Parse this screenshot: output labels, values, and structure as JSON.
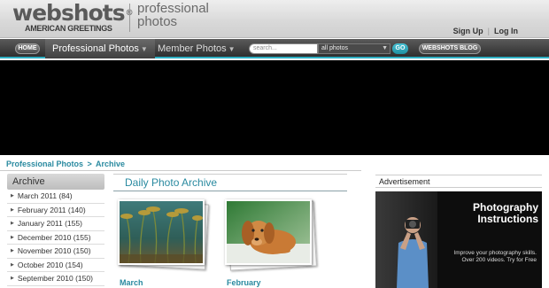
{
  "header": {
    "logo_main": "webshots",
    "logo_reg": "®",
    "logo_sub": "AMERICAN GREETINGS",
    "logo_tagline_1": "professional",
    "logo_tagline_2": "photos",
    "sign_up": "Sign Up",
    "separator": "|",
    "log_in": "Log In"
  },
  "nav": {
    "home": "HOME",
    "professional_photos": "Professional Photos",
    "professional_caret": "▼",
    "member_photos": "Member Photos",
    "member_caret": "▼",
    "search_placeholder": "search...",
    "search_scope": "all photos",
    "go": "GO",
    "blog": "WEBSHOTS BLOG"
  },
  "breadcrumb": {
    "root": "Professional Photos",
    "sep": ">",
    "current": "Archive"
  },
  "sidebar": {
    "heading": "Archive",
    "items": [
      {
        "label": "March 2011 (84)"
      },
      {
        "label": "February 2011 (140)"
      },
      {
        "label": "January 2011 (155)"
      },
      {
        "label": "December 2010 (155)"
      },
      {
        "label": "November 2010 (150)"
      },
      {
        "label": "October 2010 (154)"
      },
      {
        "label": "September 2010 (150)"
      }
    ]
  },
  "main": {
    "title": "Daily Photo Archive",
    "thumbs": [
      {
        "caption": "March"
      },
      {
        "caption": "February"
      }
    ]
  },
  "ad": {
    "label": "Advertisement",
    "title_1": "Photography",
    "title_2": "Instructions",
    "body": "Improve your photography skills. Over 200 videos. Try for Free"
  },
  "colors": {
    "accent": "#2a8aa0",
    "nav_bar": "#333333",
    "go_button": "#2fb0c4"
  }
}
